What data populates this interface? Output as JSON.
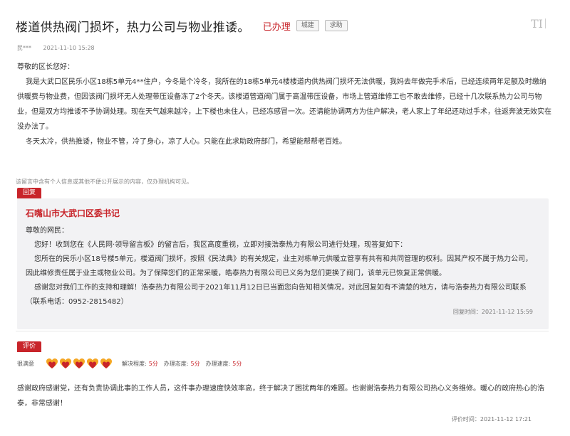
{
  "header": {
    "title": "楼道供热阀门损坏，热力公司与物业推诿。",
    "status": "已办理",
    "tags": [
      "城建",
      "求助"
    ],
    "corner_logo": "TI"
  },
  "meta": {
    "author": "民***",
    "time": "2021-11-10 15:28"
  },
  "message": {
    "salutation": "尊敬的区长您好：",
    "paragraphs": [
      "我是大武口区民乐小区18栋5单元4**住户，今冬是个冷冬，我所在的18栋5单元4楼楼道内供热阀门损坏无法供暖，我妈去年做完手术后，已经连续两年足额及时缴纳供暖费与物业费，但因该阀门损坏无人处理带压设备冻了2个冬天。该楼道管道阀门属于高温带压设备，市场上管道维修工也不敢去维修，已经十几次联系热力公司与物业，但是双方均推诿不予协调处理。现在天气越来越冷，上下楼也未住人，已经冻感冒一次。还请能协调两方为住户解决，老人家上了年纪还动过手术，往返奔波无效实在没办法了。",
      "冬天太冷，供热推诿，物业不管，冷了身心，凉了人心。只能在此求助政府部门，希望能帮帮老百姓。"
    ]
  },
  "notice": "该留言中含有个人信息或其他不便公开展示的内容，仅办理机构可见。",
  "reply": {
    "tab_label": "回复",
    "org": "石嘴山市大武口区委书记",
    "salutation": "尊敬的网民：",
    "paragraphs": [
      "您好！收到您在《人民网·领导留言板》的留言后，我区高度重视，立即对接浩泰热力有限公司进行处理，现答复如下：",
      "您所在的民乐小区18号楼5单元，楼道阀门损坏，按照《民法典》的有关规定，业主对栋单元供暖立管享有共有和共同管理的权利。因其产权不属于热力公司，因此维修责任属于业主或物业公司。为了保障您们的正常采暖，皓泰热力有限公司已义务为您们更换了阀门，该单元已恢复正常供暖。",
      "感谢您对我们工作的支持和理解！浩泰热力有限公司于2021年11月12日已当面您向告知相关情况，对此回复如有不清楚的地方，请与浩泰热力有限公司联系（联系电话：0952-2815482）"
    ],
    "time": "回复时间：2021-11-12 15:59"
  },
  "evaluation": {
    "tab_label": "评价",
    "rating_label": "很满意",
    "hearts_filled": 5,
    "hearts_total": 5,
    "scores": [
      {
        "label": "解决程度:",
        "value": "5分"
      },
      {
        "label": "办理态度:",
        "value": "5分"
      },
      {
        "label": "办理速度:",
        "value": "5分"
      }
    ],
    "text": "感谢政府感谢党，还有负责协调此事的工作人员，这件事办理速度快效率高，终于解决了困扰两年的难题。也谢谢浩泰热力有限公司热心义务维修。暖心的政府热心的浩泰，非常感谢！",
    "time": "评价时间：2021-11-12 17:21"
  },
  "colors": {
    "accent": "#c8242a",
    "heart_orange": "#f5a623"
  }
}
